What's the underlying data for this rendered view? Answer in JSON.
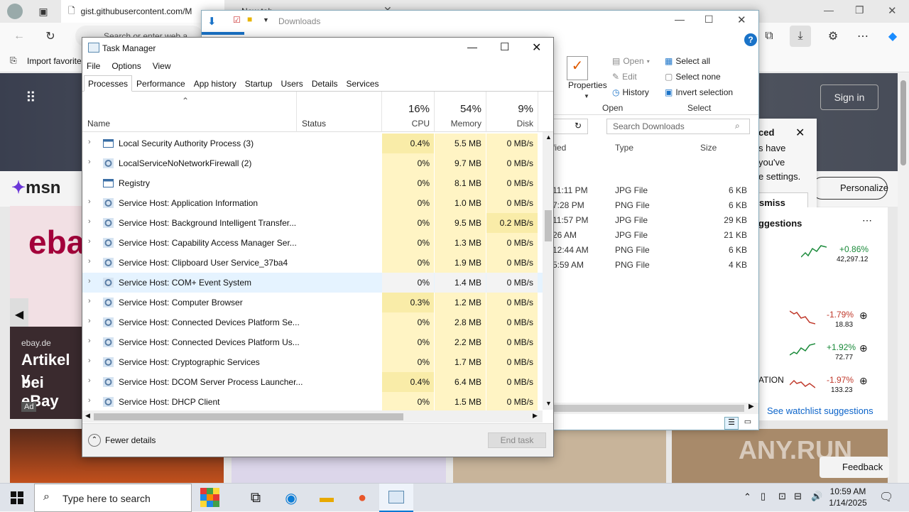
{
  "browser": {
    "tabs": [
      {
        "label": "gist.githubusercontent.com/M"
      },
      {
        "label": "New tab"
      }
    ],
    "address_placeholder": "Search or enter web a",
    "favorites": {
      "import_label": "Import favorite"
    },
    "msn": {
      "logo": "msn",
      "sign_in": "Sign in",
      "personalize": "Personalize",
      "ad": {
        "source": "ebay.de",
        "headline1": "Artikel v",
        "headline2": "bei eBay",
        "badge": "Ad",
        "logo": "eba"
      },
      "settings_tip": {
        "title": "ced",
        "line1": "s have",
        "line2": "you've",
        "line3": "e settings.",
        "dismiss": "smiss"
      },
      "suggestions_header": "ggestions",
      "stocks": [
        {
          "change": "+0.86%",
          "price": "42,297.12",
          "trend": "up"
        },
        {
          "change": "-1.79%",
          "price": "18.83",
          "trend": "down"
        },
        {
          "change": "+1.92%",
          "price": "72.77",
          "trend": "up"
        },
        {
          "name": "ATION",
          "change": "-1.97%",
          "price": "133.23",
          "trend": "down"
        }
      ],
      "watchlist_link": "See watchlist suggestions",
      "feedback": "Feedback",
      "watermark": "ANY.RUN"
    }
  },
  "explorer": {
    "title": "Downloads",
    "ribbon": {
      "properties": "Properties",
      "open": "Open",
      "edit": "Edit",
      "history": "History",
      "select_all": "Select all",
      "select_none": "Select none",
      "invert_selection": "Invert selection",
      "group_open": "Open",
      "group_select": "Select"
    },
    "search_placeholder": "Search Downloads",
    "columns": {
      "modified": "fied",
      "type": "Type",
      "size": "Size"
    },
    "files": [
      {
        "time": "11:11 PM",
        "type": "JPG File",
        "size": "6 KB"
      },
      {
        "time": "7:28 PM",
        "type": "PNG File",
        "size": "6 KB"
      },
      {
        "time": "11:57 PM",
        "type": "JPG File",
        "size": "29 KB"
      },
      {
        "time": "26 AM",
        "type": "JPG File",
        "size": "21 KB"
      },
      {
        "time": "12:44 AM",
        "type": "PNG File",
        "size": "6 KB"
      },
      {
        "time": "5:59 AM",
        "type": "PNG File",
        "size": "4 KB"
      }
    ]
  },
  "taskmgr": {
    "title": "Task Manager",
    "menus": [
      "File",
      "Options",
      "View"
    ],
    "tabs": [
      "Processes",
      "Performance",
      "App history",
      "Startup",
      "Users",
      "Details",
      "Services"
    ],
    "columns": {
      "name": "Name",
      "status": "Status",
      "cpu_pct": "16%",
      "cpu": "CPU",
      "mem_pct": "54%",
      "mem": "Memory",
      "disk_pct": "9%",
      "disk": "Disk"
    },
    "processes": [
      {
        "name": "Local Security Authority Process (3)",
        "cpu": "0.4%",
        "mem": "5.5 MB",
        "disk": "0 MB/s",
        "expandable": true
      },
      {
        "name": "LocalServiceNoNetworkFirewall (2)",
        "cpu": "0%",
        "mem": "9.7 MB",
        "disk": "0 MB/s",
        "expandable": true
      },
      {
        "name": "Registry",
        "cpu": "0%",
        "mem": "8.1 MB",
        "disk": "0 MB/s",
        "expandable": false
      },
      {
        "name": "Service Host: Application Information",
        "cpu": "0%",
        "mem": "1.0 MB",
        "disk": "0 MB/s",
        "expandable": true
      },
      {
        "name": "Service Host: Background Intelligent Transfer...",
        "cpu": "0%",
        "mem": "9.5 MB",
        "disk": "0.2 MB/s",
        "expandable": true
      },
      {
        "name": "Service Host: Capability Access Manager Ser...",
        "cpu": "0%",
        "mem": "1.3 MB",
        "disk": "0 MB/s",
        "expandable": true
      },
      {
        "name": "Service Host: Clipboard User Service_37ba4",
        "cpu": "0%",
        "mem": "1.9 MB",
        "disk": "0 MB/s",
        "expandable": true
      },
      {
        "name": "Service Host: COM+ Event System",
        "cpu": "0%",
        "mem": "1.4 MB",
        "disk": "0 MB/s",
        "expandable": true,
        "selected": true
      },
      {
        "name": "Service Host: Computer Browser",
        "cpu": "0.3%",
        "mem": "1.2 MB",
        "disk": "0 MB/s",
        "expandable": true
      },
      {
        "name": "Service Host: Connected Devices Platform Se...",
        "cpu": "0%",
        "mem": "2.8 MB",
        "disk": "0 MB/s",
        "expandable": true
      },
      {
        "name": "Service Host: Connected Devices Platform Us...",
        "cpu": "0%",
        "mem": "2.2 MB",
        "disk": "0 MB/s",
        "expandable": true
      },
      {
        "name": "Service Host: Cryptographic Services",
        "cpu": "0%",
        "mem": "1.7 MB",
        "disk": "0 MB/s",
        "expandable": true
      },
      {
        "name": "Service Host: DCOM Server Process Launcher...",
        "cpu": "0.4%",
        "mem": "6.4 MB",
        "disk": "0 MB/s",
        "expandable": true
      },
      {
        "name": "Service Host: DHCP Client",
        "cpu": "0%",
        "mem": "1.5 MB",
        "disk": "0 MB/s",
        "expandable": true
      }
    ],
    "fewer_details": "Fewer details",
    "end_task": "End task"
  },
  "taskbar": {
    "search_placeholder": "Type here to search",
    "time": "10:59 AM",
    "date": "1/14/2025"
  },
  "colors": {
    "accent": "#0078d4",
    "cpu_fill": "#fff4c4",
    "selected": "#e5f3ff"
  }
}
